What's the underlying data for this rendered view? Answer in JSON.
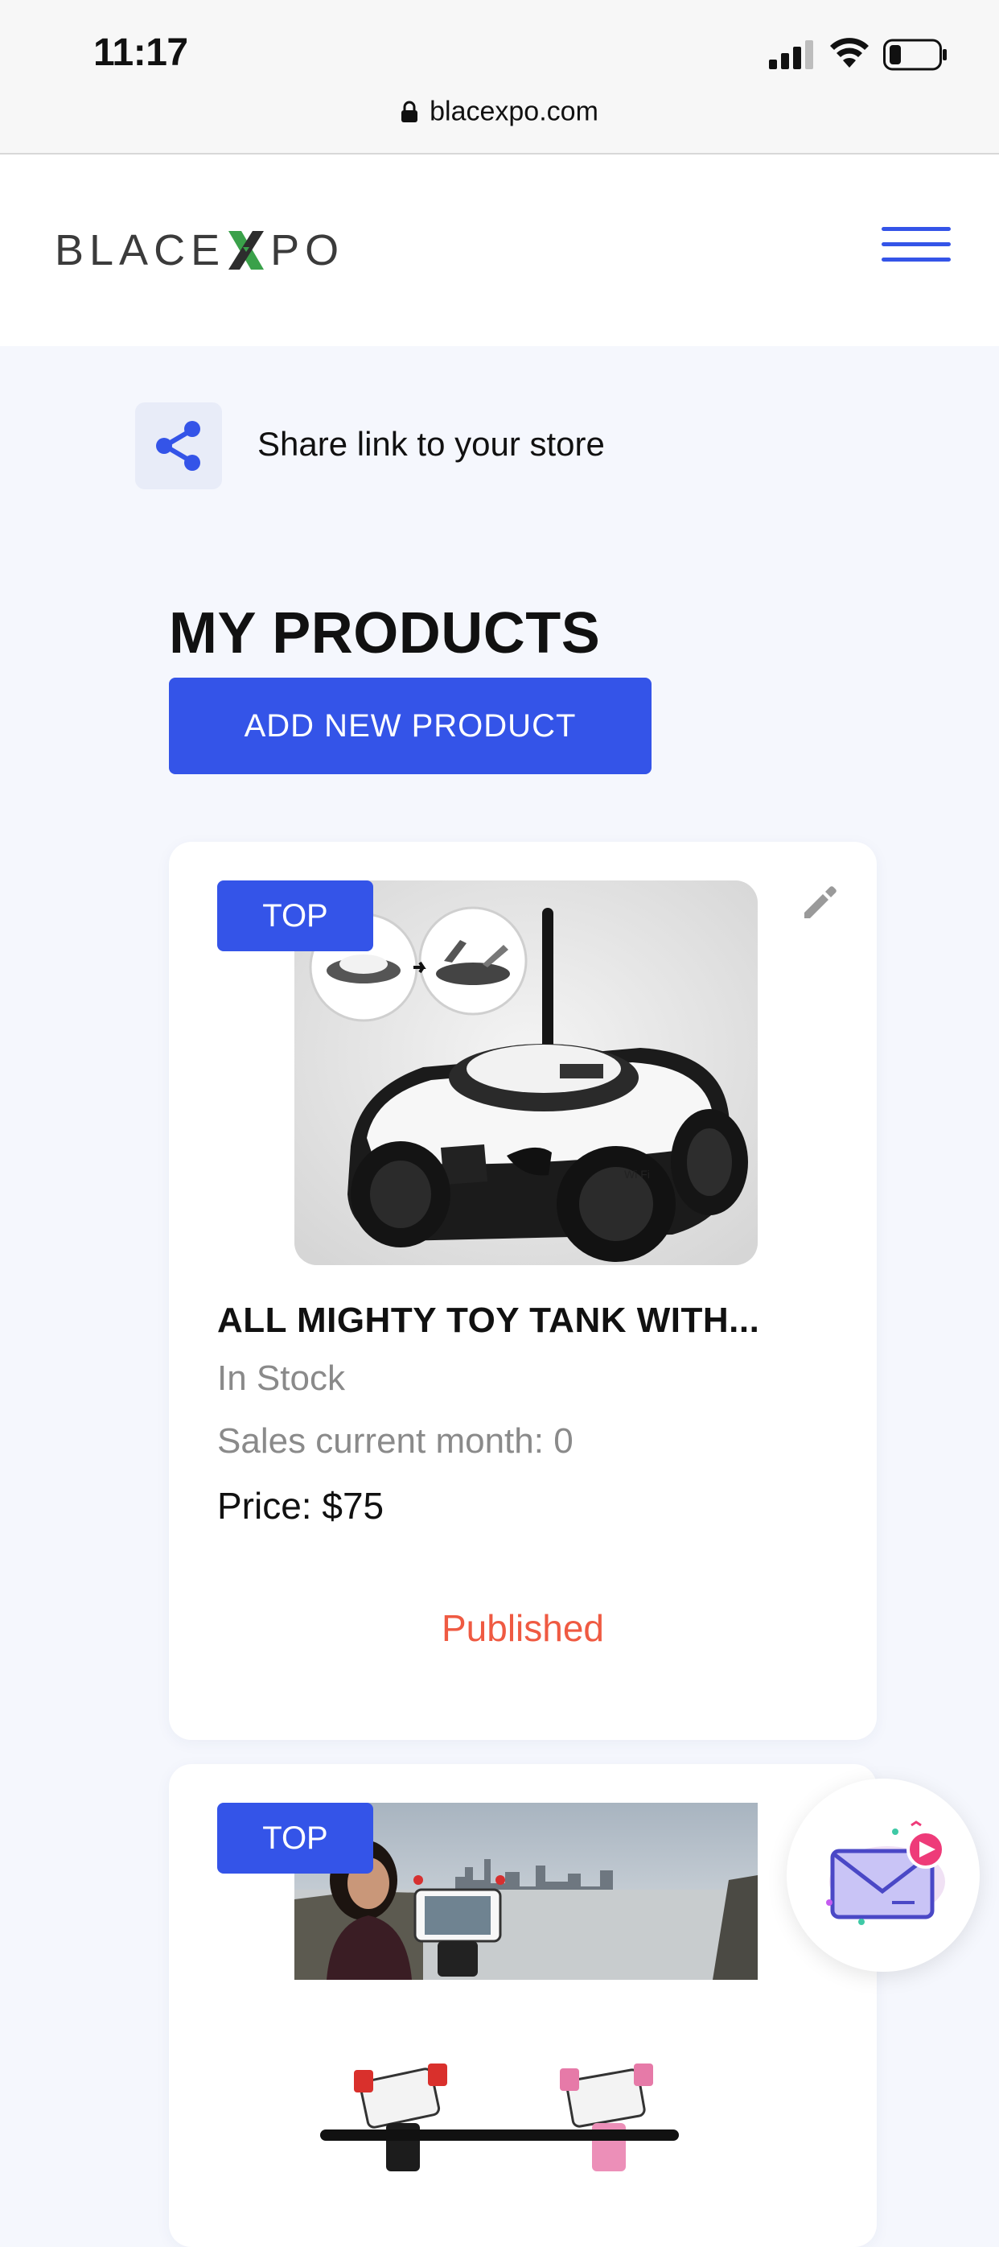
{
  "status_bar": {
    "time": "11:17",
    "url": "blacexpo.com"
  },
  "header": {
    "logo_text_left": "BLACE",
    "logo_text_right": "PO"
  },
  "share": {
    "label": "Share link to your store"
  },
  "products_section": {
    "title": "MY PRODUCTS",
    "add_button": "ADD NEW PRODUCT"
  },
  "products": [
    {
      "badge": "TOP",
      "title": "ALL MIGHTY TOY TANK WITH...",
      "stock": "In Stock",
      "sales": "Sales current month: 0",
      "price": "Price: $75",
      "status": "Published",
      "image": "toy-tank-photo"
    },
    {
      "badge": "TOP",
      "image": "phone-holder-photo"
    }
  ],
  "colors": {
    "accent": "#3454e8",
    "published": "#ef5a42",
    "logo_green": "#3aa14a",
    "background": "#f5f7fd"
  }
}
